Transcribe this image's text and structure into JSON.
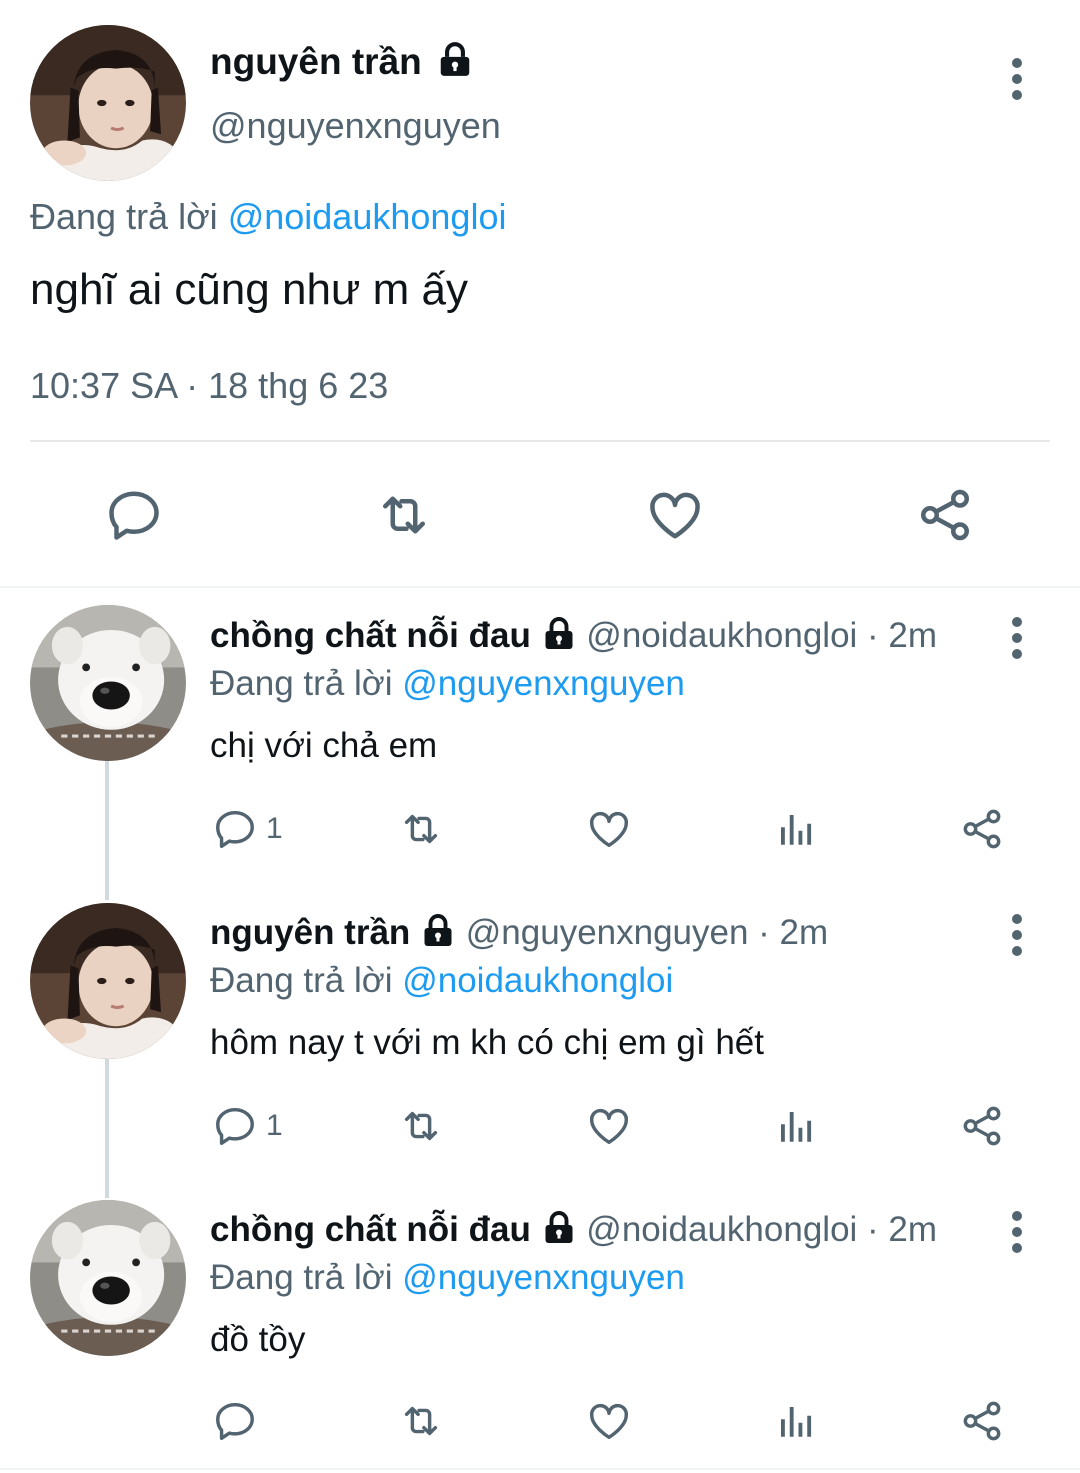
{
  "main_tweet": {
    "display_name": "nguyên trần",
    "handle": "@nguyenxnguyen",
    "reply_prefix": "Đang trả lời",
    "reply_to": "@noidaukhongloi",
    "text": "nghĩ ai cũng như m ấy",
    "timestamp": "10:37 SA · 18 thg 6 23"
  },
  "replies": [
    {
      "display_name": "chồng chất nỗi đau",
      "handle_time": "@noidaukhongloi · 2m",
      "reply_prefix": "Đang trả lời",
      "reply_to": "@nguyenxnguyen",
      "text": "chị với chả em",
      "reply_count": "1",
      "avatar": "dog"
    },
    {
      "display_name": "nguyên trần",
      "handle_time": "@nguyenxnguyen · 2m",
      "reply_prefix": "Đang trả lời",
      "reply_to": "@noidaukhongloi",
      "text": "hôm nay t với m kh có chị em gì hết",
      "reply_count": "1",
      "avatar": "girl"
    },
    {
      "display_name": "chồng chất nỗi đau",
      "handle_time": "@noidaukhongloi · 2m",
      "reply_prefix": "Đang trả lời",
      "reply_to": "@nguyenxnguyen",
      "text": "đồ tồy",
      "reply_count": "",
      "avatar": "dog"
    }
  ],
  "colors": {
    "text": "#0f1419",
    "secondary": "#536471",
    "link": "#1d9bf0",
    "divider": "#e7e9ea"
  },
  "icons": [
    "lock-icon",
    "more-vertical-icon",
    "reply-icon",
    "retweet-icon",
    "like-icon",
    "share-icon",
    "analytics-icon"
  ]
}
